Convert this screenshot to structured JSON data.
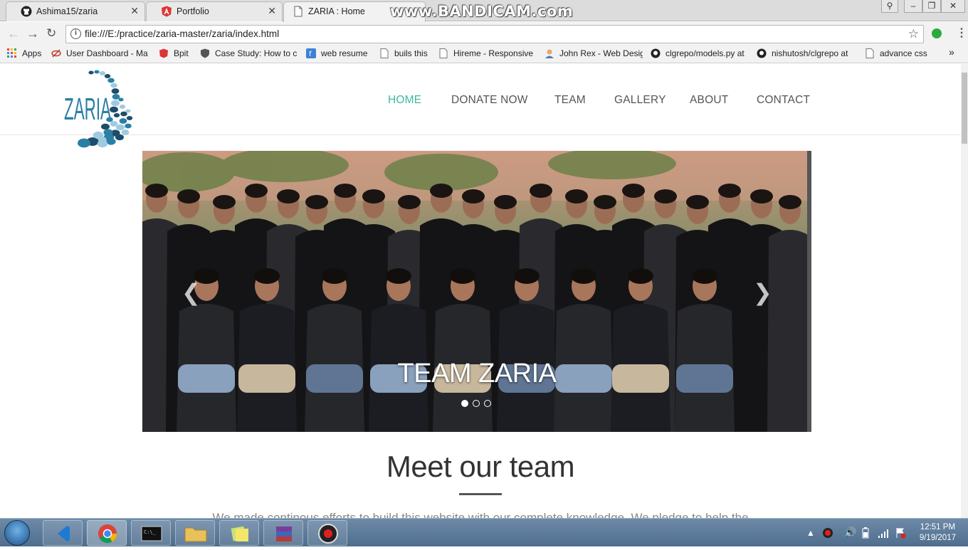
{
  "browser": {
    "tabs": [
      {
        "title": "Ashima15/zaria",
        "icon": "github-icon"
      },
      {
        "title": "Portfolio",
        "icon": "angular-icon"
      },
      {
        "title": "ZARIA : Home",
        "icon": "document-icon"
      }
    ],
    "watermark": "www.BANDICAM.com",
    "url": "file:///E:/practice/zaria-master/zaria/index.html",
    "bookmarks": [
      {
        "label": "Apps"
      },
      {
        "label": "User Dashboard - Ma"
      },
      {
        "label": "Bpit"
      },
      {
        "label": "Case Study: How to c"
      },
      {
        "label": "web resume"
      },
      {
        "label": "buils this"
      },
      {
        "label": "Hireme - Responsive"
      },
      {
        "label": "John Rex - Web Desig"
      },
      {
        "label": "clgrepo/models.py at"
      },
      {
        "label": "nishutosh/clgrepo at"
      },
      {
        "label": "advance css"
      }
    ],
    "more_bookmarks": "»"
  },
  "site": {
    "logo_text": "ZARIA",
    "nav": [
      {
        "label": "HOME",
        "active": true
      },
      {
        "label": "DONATE NOW",
        "active": false
      },
      {
        "label": "TEAM",
        "active": false
      },
      {
        "label": "GALLERY",
        "active": false
      },
      {
        "label": "ABOUT",
        "active": false
      },
      {
        "label": "CONTACT",
        "active": false
      }
    ],
    "carousel": {
      "caption": "TEAM ZARIA",
      "slides": 3,
      "active_slide": 1
    },
    "team_heading": "Meet our team",
    "team_text": "We made continous efforts to build this website with our complete knowledge. We pledge to help the"
  },
  "taskbar": {
    "time": "12:51 PM",
    "date": "9/19/2017"
  },
  "colors": {
    "accent": "#3fb8a2",
    "logo_blue": "#2b7fa5",
    "logo_dark": "#1e4d6b"
  }
}
